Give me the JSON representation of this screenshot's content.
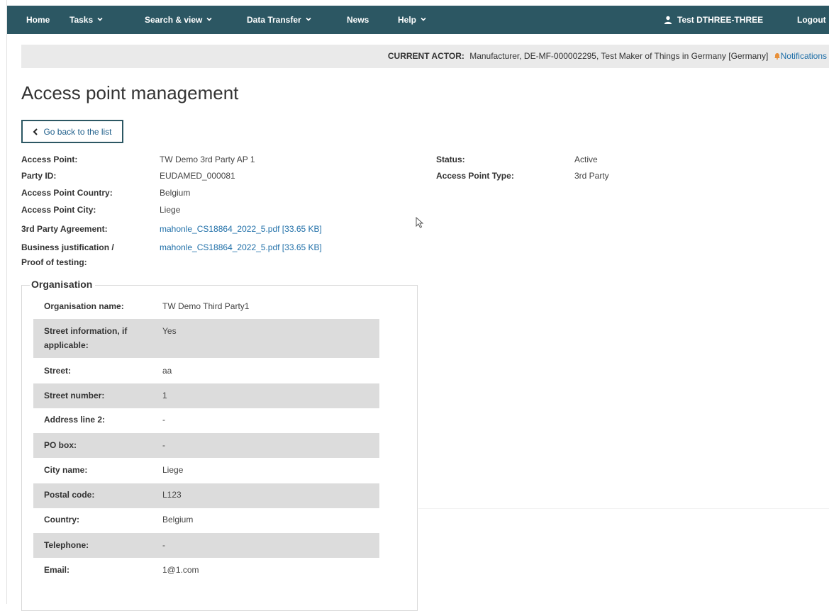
{
  "nav": {
    "home": "Home",
    "tasks": "Tasks",
    "search_view": "Search & view",
    "data_transfer": "Data Transfer",
    "news": "News",
    "help": "Help",
    "user": "Test DTHREE-THREE",
    "logout": "Logout"
  },
  "actor": {
    "label": "CURRENT ACTOR:",
    "value": "Manufacturer, DE-MF-000002295, Test Maker of Things in Germany [Germany]",
    "notifications": "Notifications"
  },
  "page_title": "Access point management",
  "back_button": "Go back to the list",
  "details": {
    "access_point": {
      "label": "Access Point:",
      "value": "TW Demo 3rd Party AP 1"
    },
    "party_id": {
      "label": "Party ID:",
      "value": "EUDAMED_000081"
    },
    "country": {
      "label": "Access Point Country:",
      "value": "Belgium"
    },
    "city": {
      "label": "Access Point City:",
      "value": "Liege"
    },
    "agreement": {
      "label": "3rd Party Agreement:",
      "value": "mahonle_CS18864_2022_5.pdf [33.65 KB]"
    },
    "justification": {
      "label_line1": "Business justification /",
      "label_line2": "Proof of testing:",
      "value": "mahonle_CS18864_2022_5.pdf [33.65 KB]"
    },
    "status": {
      "label": "Status:",
      "value": "Active"
    },
    "type": {
      "label": "Access Point Type:",
      "value": "3rd Party"
    }
  },
  "organisation": {
    "legend": "Organisation",
    "rows": [
      {
        "label": "Organisation name:",
        "value": "TW Demo Third Party1"
      },
      {
        "label": "Street information, if applicable:",
        "value": "Yes"
      },
      {
        "label": "Street:",
        "value": "aa"
      },
      {
        "label": "Street number:",
        "value": "1"
      },
      {
        "label": "Address line 2:",
        "value": "-"
      },
      {
        "label": "PO box:",
        "value": "-"
      },
      {
        "label": "City name:",
        "value": "Liege"
      },
      {
        "label": "Postal code:",
        "value": "L123"
      },
      {
        "label": "Country:",
        "value": "Belgium"
      },
      {
        "label": "Telephone:",
        "value": "-"
      },
      {
        "label": "Email:",
        "value": "1@1.com"
      }
    ]
  },
  "colors": {
    "navbar": "#2c5763",
    "link": "#1f6fa8",
    "shaded_row": "#dcdcdc",
    "actor_bar": "#eaeaea"
  },
  "icons": [
    "chevron-down-icon",
    "user-icon",
    "bell-icon",
    "chevron-left-icon",
    "mouse-cursor-icon"
  ]
}
